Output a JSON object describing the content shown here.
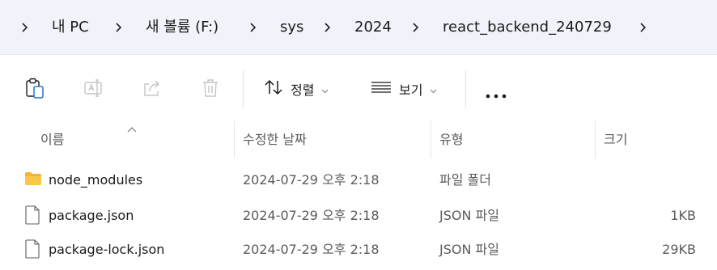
{
  "breadcrumb": {
    "items": [
      "내 PC",
      "새 볼륨 (F:)",
      "sys",
      "2024",
      "react_backend_240729"
    ]
  },
  "toolbar": {
    "clipboard_icon": "clipboard-icon",
    "rename_icon": "rename-icon",
    "share_icon": "share-icon",
    "delete_icon": "trash-icon",
    "sort_label": "정렬",
    "view_label": "보기",
    "more_icon": "more-icon"
  },
  "columns": {
    "name": "이름",
    "date": "수정한 날짜",
    "type": "유형",
    "size": "크기"
  },
  "files": [
    {
      "name": "node_modules",
      "date": "2024-07-29 오후 2:18",
      "type": "파일 폴더",
      "size": "",
      "icon": "folder-icon"
    },
    {
      "name": "package.json",
      "date": "2024-07-29 오후 2:18",
      "type": "JSON 파일",
      "size": "1KB",
      "icon": "file-icon"
    },
    {
      "name": "package-lock.json",
      "date": "2024-07-29 오후 2:18",
      "type": "JSON 파일",
      "size": "29KB",
      "icon": "file-icon"
    }
  ],
  "colors": {
    "breadcrumb_bg": "#f0f3f9",
    "folder": "#f8c846",
    "disabled_icon": "#c5c5c5"
  }
}
